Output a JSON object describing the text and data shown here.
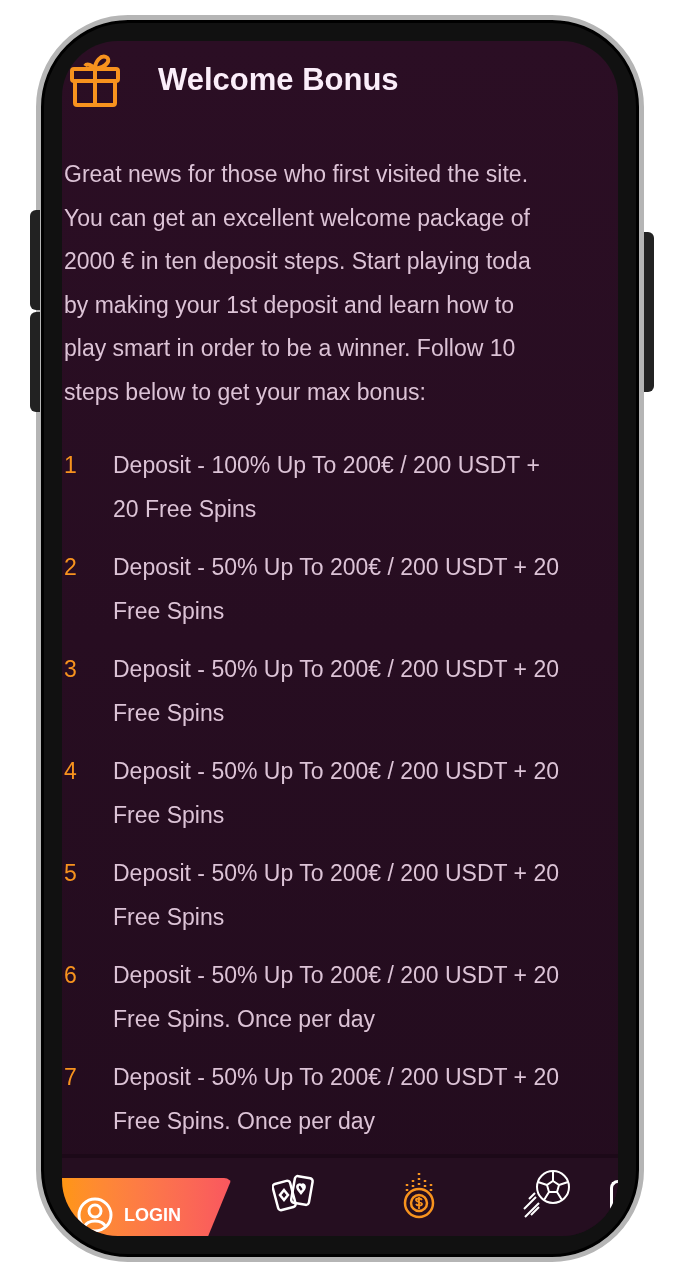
{
  "header": {
    "title": "Welcome Bonus"
  },
  "intro": {
    "lines": [
      "Great news for those who first visited the site.",
      "You can get an excellent welcome package of",
      "2000 € in ten deposit steps. Start playing toda",
      "by making your 1st deposit and learn how to",
      "play smart in order to be a winner. Follow 10",
      "steps below to get your max bonus:"
    ]
  },
  "steps": [
    {
      "number": "1",
      "lines": [
        "Deposit - 100% Up To 200€ / 200 USDT +",
        "20 Free Spins"
      ]
    },
    {
      "number": "2",
      "lines": [
        "Deposit - 50% Up To 200€ / 200 USDT + 20",
        "Free Spins"
      ]
    },
    {
      "number": "3",
      "lines": [
        "Deposit - 50% Up To 200€ / 200 USDT + 20",
        "Free Spins"
      ]
    },
    {
      "number": "4",
      "lines": [
        "Deposit - 50% Up To 200€ / 200 USDT + 20",
        "Free Spins"
      ]
    },
    {
      "number": "5",
      "lines": [
        "Deposit - 50% Up To 200€ / 200 USDT + 20",
        "Free Spins"
      ]
    },
    {
      "number": "6",
      "lines": [
        "Deposit - 50% Up To 200€ / 200 USDT + 20",
        "Free Spins. Once per day"
      ]
    },
    {
      "number": "7",
      "lines": [
        "Deposit - 50% Up To 200€ / 200 USDT + 20",
        "Free Spins. Once per day"
      ]
    }
  ],
  "bottom_nav": {
    "login": {
      "label": "LOGIN"
    },
    "items": [
      {
        "kind": "cards",
        "selected": false
      },
      {
        "kind": "coin",
        "selected": true
      },
      {
        "kind": "ball",
        "selected": false
      }
    ]
  }
}
